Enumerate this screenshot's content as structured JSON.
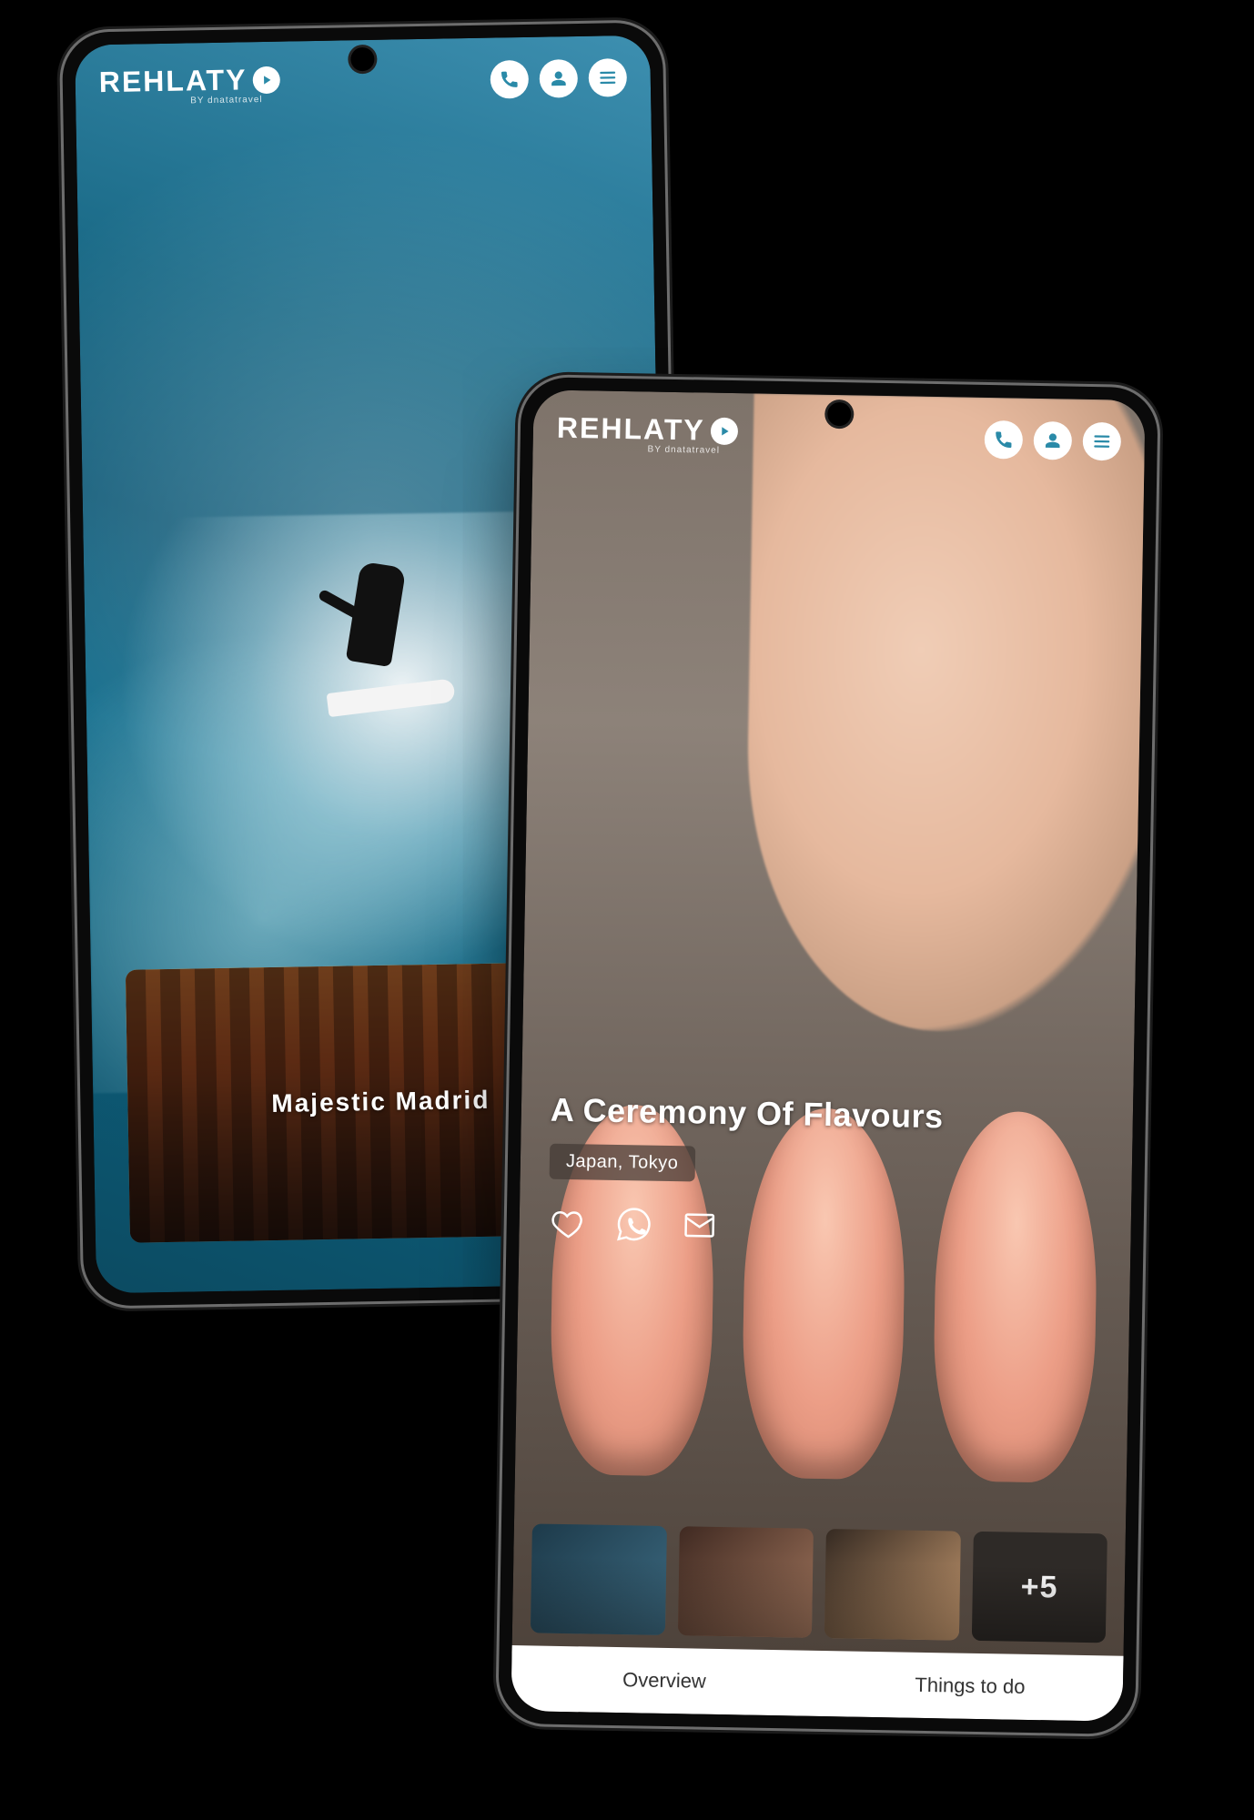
{
  "brand_name": "REHLATY",
  "brand_tagline": "BY dnatatravel",
  "header_icons": {
    "phone": "phone-icon",
    "user": "user-icon",
    "menu": "menu-icon"
  },
  "back_phone": {
    "promo_title": "Majestic Madrid",
    "hero_description": "surfer-on-wave"
  },
  "front_phone": {
    "title": "A Ceremony Of Flavours",
    "location": "Japan, Tokyo",
    "actions": [
      "favorite",
      "share-whatsapp",
      "share-email"
    ],
    "extra_thumbs_label": "+5",
    "tabs": [
      {
        "label": "Overview"
      },
      {
        "label": "Things to do"
      }
    ]
  },
  "colors": {
    "accent": "#2a8aa8",
    "white": "#ffffff"
  }
}
